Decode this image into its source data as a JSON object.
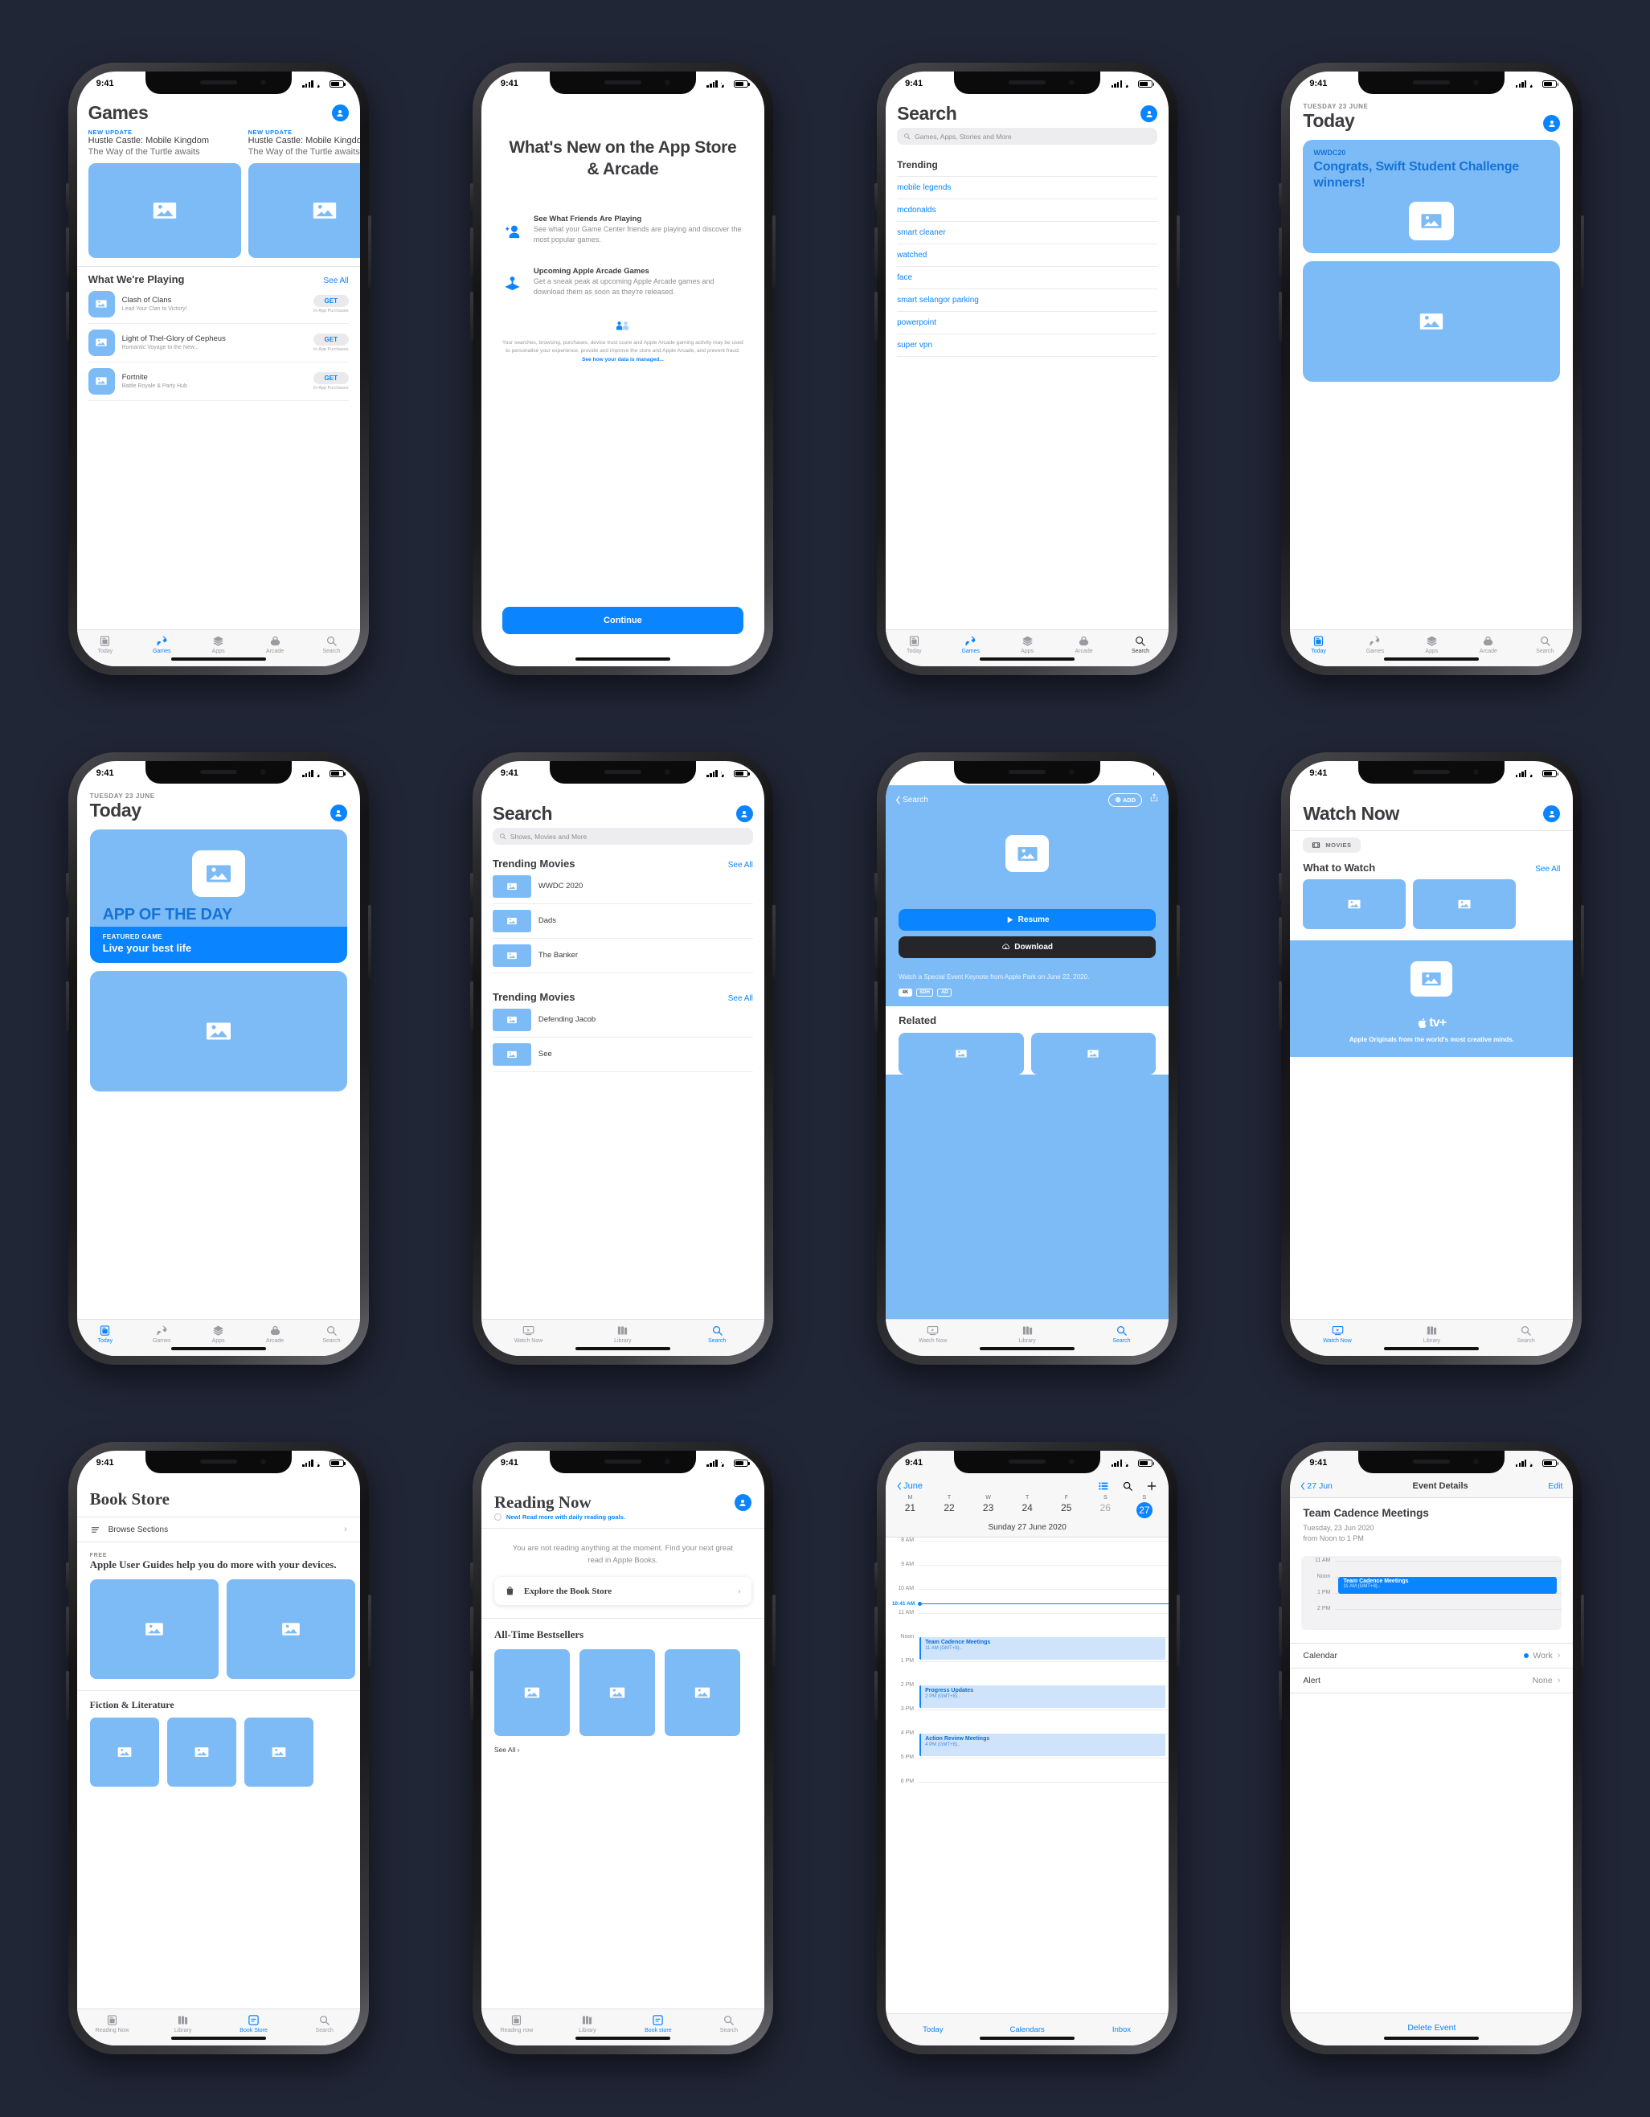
{
  "status_bar": {
    "time": "9:41"
  },
  "phone1": {
    "title": "Games",
    "cards": [
      {
        "kicker": "NEW UPDATE",
        "line1": "Hustle Castle: Mobile Kingdom",
        "line2": "The Way of the Turtle awaits"
      },
      {
        "kicker": "NEW UPDATE",
        "line1": "Hustle Castle: Mobile Kingdom",
        "line2": "The Way of the Turtle awaits"
      }
    ],
    "section": {
      "title": "What We're Playing",
      "see_all": "See All"
    },
    "apps": [
      {
        "name": "Clash of Clans",
        "subtitle": "Lead Your Clan to Victory!",
        "cta": "GET",
        "note": "In-App Purchases"
      },
      {
        "name": "Light of Thel-Glory of Cepheus",
        "subtitle": "Romantic Voyage to the New...",
        "cta": "GET",
        "note": "In-App Purchases"
      },
      {
        "name": "Fortnite",
        "subtitle": "Battle Royale & Party Hub",
        "cta": "GET",
        "note": "In-App Purchases"
      }
    ],
    "tabs": [
      "Today",
      "Games",
      "Apps",
      "Arcade",
      "Search"
    ],
    "active_tab": "Games"
  },
  "phone2": {
    "heading": "What's New on the App Store & Arcade",
    "features": [
      {
        "title": "See What Friends Are Playing",
        "desc": "See what your Game Center friends are playing and discover the most popular games."
      },
      {
        "title": "Upcoming Apple Arcade Games",
        "desc": "Get a sneak peak at upcoming Apple Arcade games and download them as soon as they're released."
      }
    ],
    "privacy_text": "Your searches, browsing, purchases, device trust score and Apple Arcade gaming activity may be used to personalise your experience, provide and improve the store and Apple Arcade, and prevent fraud. ",
    "privacy_link": "See how your data is managed...",
    "continue": "Continue"
  },
  "phone3": {
    "title": "Search",
    "placeholder": "Games, Apps, Stories and More",
    "trending_title": "Trending",
    "trending": [
      "mobile legends",
      "mcdonalds",
      "smart cleaner",
      "watched",
      "face",
      "smart selangor parking",
      "powerpoint",
      "super vpn"
    ],
    "tabs": [
      "Today",
      "Games",
      "Apps",
      "Arcade",
      "Search"
    ],
    "active_tab": "Search"
  },
  "phone4": {
    "date": "TUESDAY 23 JUNE",
    "title": "Today",
    "card": {
      "kicker": "WWDC20",
      "headline": "Congrats, Swift Student Challenge winners!"
    },
    "tabs": [
      "Today",
      "Games",
      "Apps",
      "Arcade",
      "Search"
    ],
    "active_tab": "Today"
  },
  "phone5": {
    "date": "TUESDAY 23 JUNE",
    "title": "Today",
    "hero_words": "APP OF THE DAY",
    "footer_kicker": "FEATURED GAME",
    "footer_title": "Live your best life",
    "tabs": [
      "Today",
      "Games",
      "Apps",
      "Arcade",
      "Search"
    ],
    "active_tab": "Today"
  },
  "phone6": {
    "title": "Search",
    "placeholder": "Shows, Movies and More",
    "sections": [
      {
        "title": "Trending Movies",
        "see_all": "See All",
        "items": [
          "WWDC 2020",
          "Dads",
          "The Banker"
        ]
      },
      {
        "title": "Trending Movies",
        "see_all": "See All",
        "items": [
          "Defending Jacob",
          "See"
        ]
      }
    ],
    "tabs": [
      "Watch Now",
      "Library",
      "Search"
    ],
    "active_tab": "Search"
  },
  "phone7": {
    "back": "Search",
    "add": "ADD",
    "resume": "Resume",
    "download": "Download",
    "description": "Watch a Special Event Keynote from Apple Park on June 22, 2020.",
    "badges": [
      "4K",
      "SDH",
      "AD"
    ],
    "related_title": "Related",
    "tabs": [
      "Watch Now",
      "Library",
      "Search"
    ],
    "active_tab": "Search"
  },
  "phone8": {
    "title": "Watch Now",
    "chip": "MOVIES",
    "section": {
      "title": "What to Watch",
      "see_all": "See All"
    },
    "tv_plus": "tv+",
    "tv_tagline": "Apple Originals from the world's most creative minds.",
    "tabs": [
      "Watch Now",
      "Library",
      "Search"
    ],
    "active_tab": "Watch Now"
  },
  "phone9": {
    "title": "Book Store",
    "browse": "Browse Sections",
    "free_kicker": "FREE",
    "free_title": "Apple User Guides help you do more with your devices.",
    "section_title": "Fiction & Literature",
    "tabs": [
      "Reading Now",
      "Library",
      "Book Store",
      "Search"
    ],
    "active_tab": "Book Store"
  },
  "phone10": {
    "title": "Reading Now",
    "new_badge": "New! Read more with daily reading goals.",
    "empty": "You are not reading anything at the moment. Find your next great read in Apple Books.",
    "cta": "Explore the Book Store",
    "section_title": "All-Time Bestsellers",
    "see_all": "See All",
    "tabs": [
      "Reading now",
      "Library",
      "Book store",
      "Search"
    ],
    "active_tab": "Book store"
  },
  "phone11": {
    "back": "June",
    "dows": [
      "M",
      "T",
      "W",
      "T",
      "F",
      "S",
      "S"
    ],
    "days": [
      "21",
      "22",
      "23",
      "24",
      "25",
      "26",
      "27"
    ],
    "selected_day": "27",
    "date_label": "Sunday 27 June 2020",
    "hours": [
      "8 AM",
      "9 AM",
      "10 AM",
      "11 AM",
      "Noon",
      "1 PM",
      "2 PM",
      "3 PM",
      "4 PM",
      "5 PM",
      "6 PM"
    ],
    "now_label": "10:41 AM",
    "events": [
      {
        "title": "Team Cadence Meetings",
        "time": "11 AM (GMT+8).."
      },
      {
        "title": "Progress Updates",
        "time": "2 PM (GMT+8).."
      },
      {
        "title": "Action Review Meetings",
        "time": "4 PM (GMT+8).."
      }
    ],
    "tabs": [
      "Today",
      "Calendars",
      "Inbox"
    ]
  },
  "phone12": {
    "back": "27 Jun",
    "nav_title": "Event Details",
    "edit": "Edit",
    "event_title": "Team Cadence Meetings",
    "event_date": "Tuesday, 23 Jun 2020",
    "event_time": "from Noon to 1 PM",
    "mini_hours": [
      "11 AM",
      "Noon",
      "1 PM",
      "2 PM"
    ],
    "mini_event": {
      "title": "Team Cadence Meetings",
      "time": "11 AM (GMT+8).."
    },
    "rows": [
      {
        "label": "Calendar",
        "value": "Work",
        "dot": true
      },
      {
        "label": "Alert",
        "value": "None",
        "dot": false
      }
    ],
    "delete": "Delete Event"
  }
}
